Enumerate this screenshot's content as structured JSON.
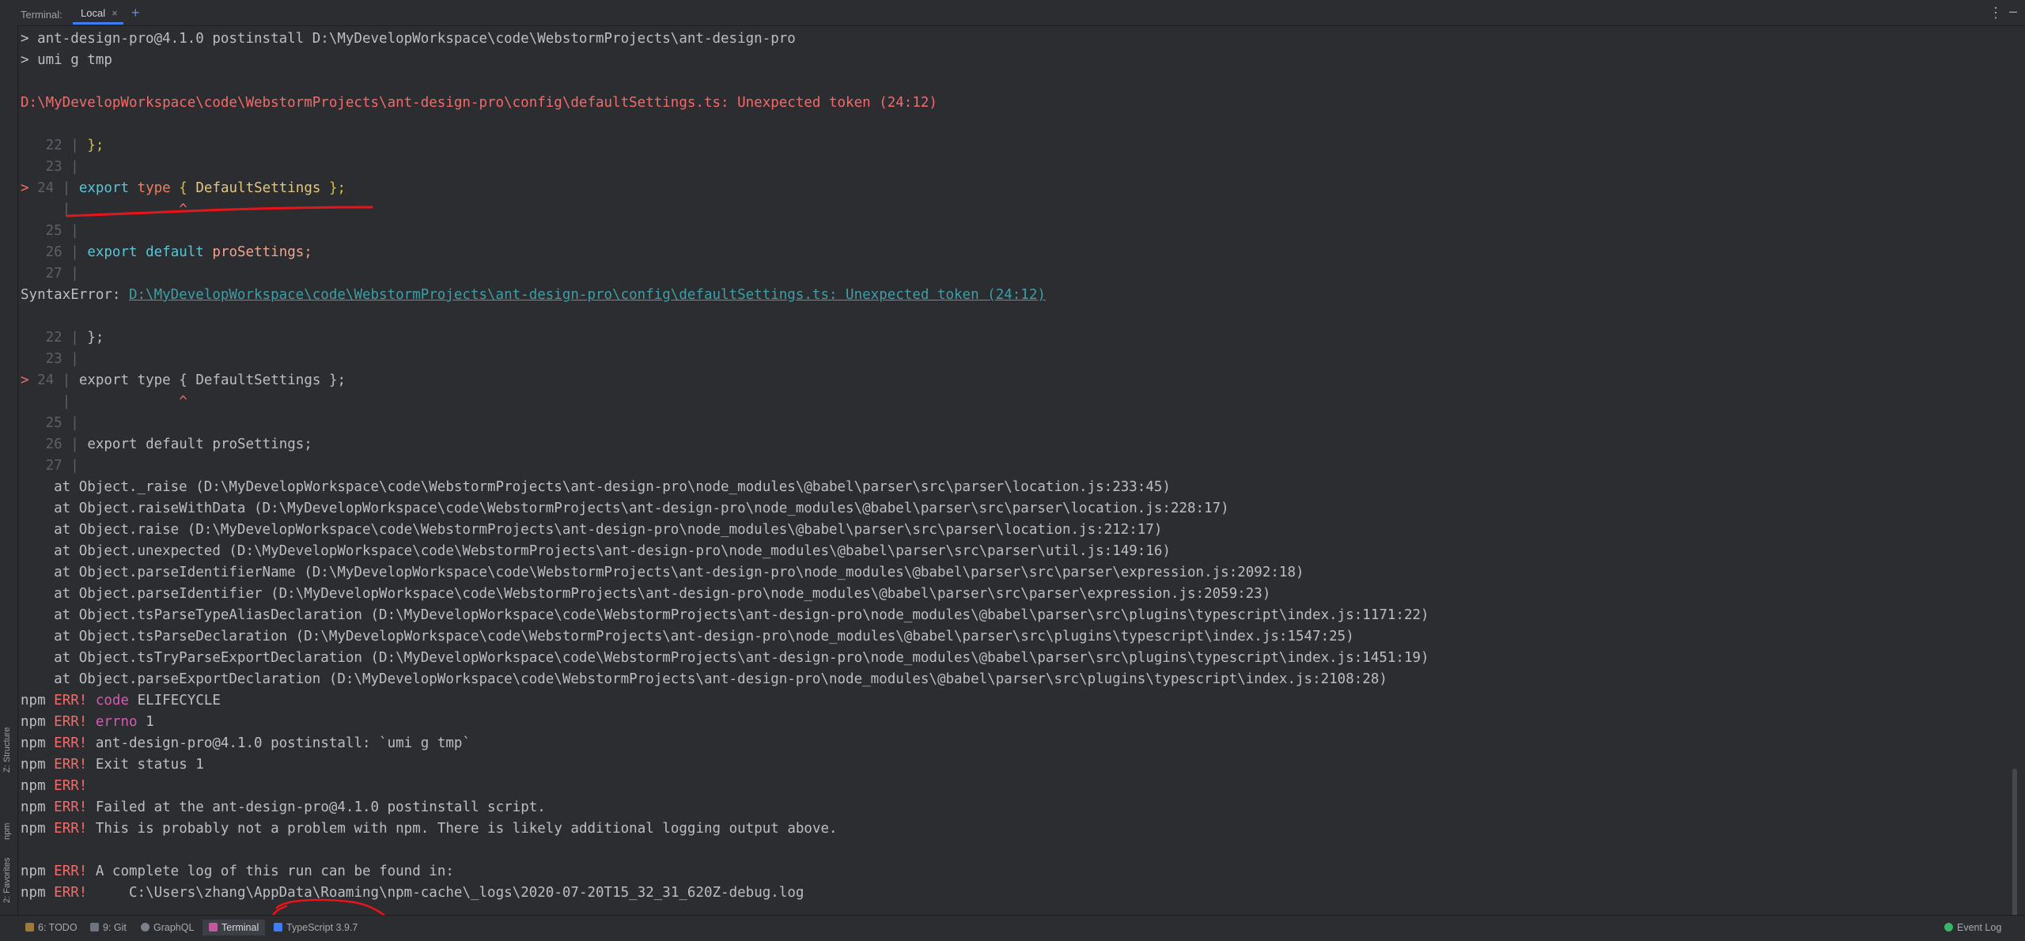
{
  "header": {
    "title": "Terminal:",
    "tab_label": "Local",
    "close_glyph": "×",
    "add_glyph": "+",
    "more_glyph": "⋮",
    "minimize_glyph": "–"
  },
  "left_strip": {
    "structure_label": "Z: Structure",
    "npm_label": "npm",
    "favorites_label": "2: Favorites"
  },
  "terminal": {
    "prompt1": "> ant-design-pro@4.1.0 postinstall D:\\MyDevelopWorkspace\\code\\WebstormProjects\\ant-design-pro",
    "prompt2": "> umi g tmp",
    "error_path": "D:\\MyDevelopWorkspace\\code\\WebstormProjects\\ant-design-pro\\config\\defaultSettings.ts: Unexpected token (24:12)",
    "syntax_error_prefix": "SyntaxError: ",
    "syntax_error_link": "D:\\MyDevelopWorkspace\\code\\WebstormProjects\\ant-design-pro\\config\\defaultSettings.ts: Unexpected token (24:12)",
    "frame1": {
      "l22": "22",
      "l22_code": "};",
      "l23": "23",
      "arrow": ">",
      "l24": "24",
      "kw_export": "export",
      "kw_type": "type",
      "brace_open": "{",
      "type_name": "DefaultSettings",
      "brace_close": "};",
      "caret": "^",
      "l25": "25",
      "l26": "26",
      "kw_default": "default",
      "pro_settings": "proSettings;",
      "l27": "27"
    },
    "stack": [
      "    at Object._raise (D:\\MyDevelopWorkspace\\code\\WebstormProjects\\ant-design-pro\\node_modules\\@babel\\parser\\src\\parser\\location.js:233:45)",
      "    at Object.raiseWithData (D:\\MyDevelopWorkspace\\code\\WebstormProjects\\ant-design-pro\\node_modules\\@babel\\parser\\src\\parser\\location.js:228:17)",
      "    at Object.raise (D:\\MyDevelopWorkspace\\code\\WebstormProjects\\ant-design-pro\\node_modules\\@babel\\parser\\src\\parser\\location.js:212:17)",
      "    at Object.unexpected (D:\\MyDevelopWorkspace\\code\\WebstormProjects\\ant-design-pro\\node_modules\\@babel\\parser\\src\\parser\\util.js:149:16)",
      "    at Object.parseIdentifierName (D:\\MyDevelopWorkspace\\code\\WebstormProjects\\ant-design-pro\\node_modules\\@babel\\parser\\src\\parser\\expression.js:2092:18)",
      "    at Object.parseIdentifier (D:\\MyDevelopWorkspace\\code\\WebstormProjects\\ant-design-pro\\node_modules\\@babel\\parser\\src\\parser\\expression.js:2059:23)",
      "    at Object.tsParseTypeAliasDeclaration (D:\\MyDevelopWorkspace\\code\\WebstormProjects\\ant-design-pro\\node_modules\\@babel\\parser\\src\\plugins\\typescript\\index.js:1171:22)",
      "    at Object.tsParseDeclaration (D:\\MyDevelopWorkspace\\code\\WebstormProjects\\ant-design-pro\\node_modules\\@babel\\parser\\src\\plugins\\typescript\\index.js:1547:25)",
      "    at Object.tsTryParseExportDeclaration (D:\\MyDevelopWorkspace\\code\\WebstormProjects\\ant-design-pro\\node_modules\\@babel\\parser\\src\\plugins\\typescript\\index.js:1451:19)",
      "    at Object.parseExportDeclaration (D:\\MyDevelopWorkspace\\code\\WebstormProjects\\ant-design-pro\\node_modules\\@babel\\parser\\src\\plugins\\typescript\\index.js:2108:28)"
    ],
    "npm_prefix": "npm",
    "npm_err": "ERR!",
    "npm1_key": "code",
    "npm1_val": "ELIFECYCLE",
    "npm2_key": "errno",
    "npm2_val": "1",
    "npm3": "ant-design-pro@4.1.0 postinstall: `umi g tmp`",
    "npm4": "Exit status 1",
    "npm6": "Failed at the ant-design-pro@4.1.0 postinstall script.",
    "npm7": "This is probably not a problem with npm. There is likely additional logging output above.",
    "npm8": "A complete log of this run can be found in:",
    "npm9": "    C:\\Users\\zhang\\AppData\\Roaming\\npm-cache\\_logs\\2020-07-20T15_32_31_620Z-debug.log"
  },
  "bottombar": {
    "todo": "6: TODO",
    "git": "9: Git",
    "graphql": "GraphQL",
    "terminal": "Terminal",
    "typescript": "TypeScript 3.9.7",
    "event_log": "Event Log"
  },
  "colors": {
    "background": "#2b2d30",
    "error_red": "#f26b6b",
    "keyword_cyan": "#56c7d8",
    "npm_key_magenta": "#d55ab6",
    "annotation_red": "#e8141a"
  }
}
